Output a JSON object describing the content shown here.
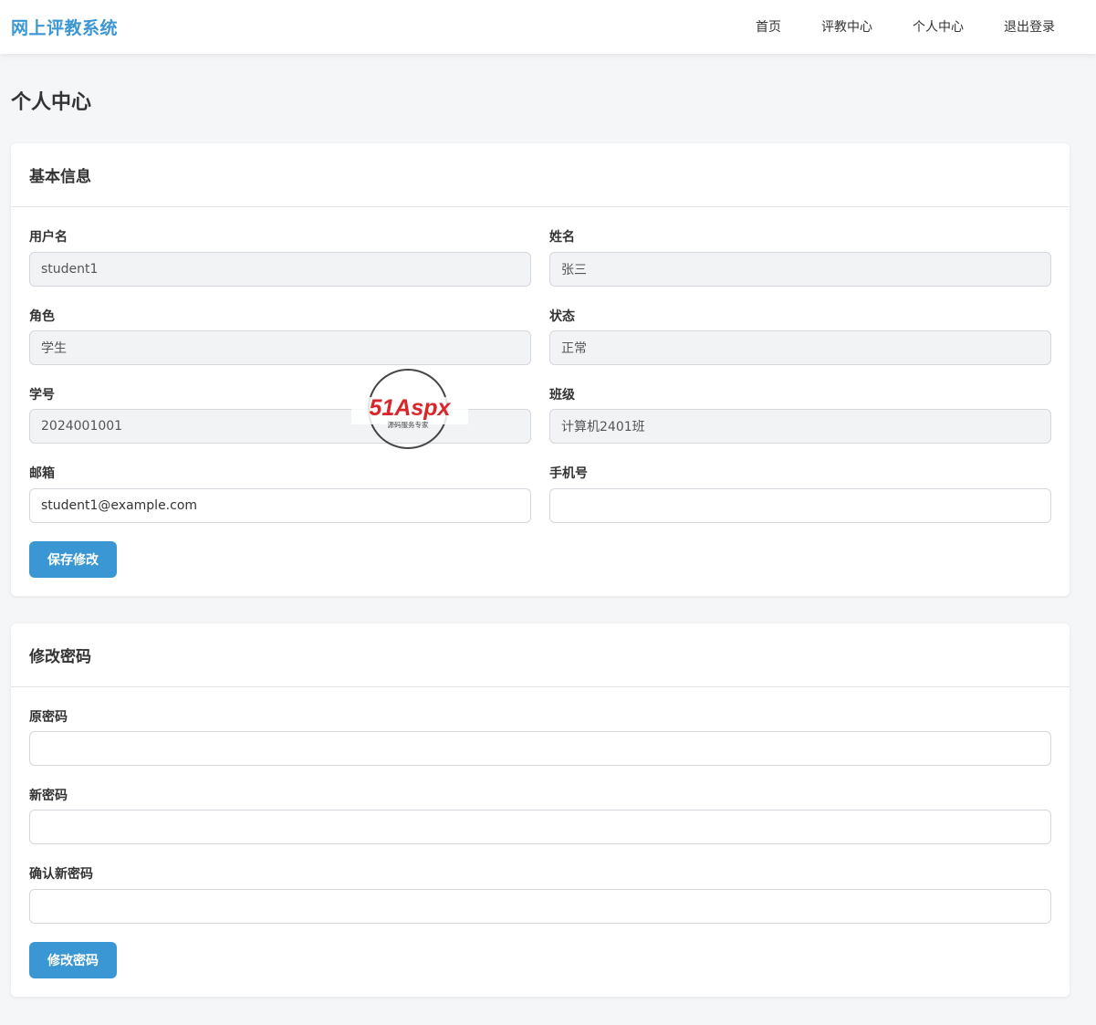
{
  "navbar": {
    "brand": "网上评教系统",
    "items": [
      {
        "label": "首页"
      },
      {
        "label": "评教中心"
      },
      {
        "label": "个人中心"
      },
      {
        "label": "退出登录"
      }
    ]
  },
  "page_title": "个人中心",
  "basic_info": {
    "title": "基本信息",
    "username": {
      "label": "用户名",
      "value": "student1"
    },
    "name": {
      "label": "姓名",
      "value": "张三"
    },
    "role": {
      "label": "角色",
      "value": "学生"
    },
    "status": {
      "label": "状态",
      "value": "正常"
    },
    "student_id": {
      "label": "学号",
      "value": "2024001001"
    },
    "class": {
      "label": "班级",
      "value": "计算机2401班"
    },
    "email": {
      "label": "邮箱",
      "value": "student1@example.com"
    },
    "phone": {
      "label": "手机号",
      "value": ""
    },
    "save_button": "保存修改"
  },
  "password": {
    "title": "修改密码",
    "old": {
      "label": "原密码",
      "value": ""
    },
    "new": {
      "label": "新密码",
      "value": ""
    },
    "confirm": {
      "label": "确认新密码",
      "value": ""
    },
    "submit_button": "修改密码"
  },
  "watermark": {
    "brand": "51Aspx",
    "tagline": "源码服务专家"
  },
  "colors": {
    "accent": "#3b97d3",
    "background": "#f5f6f8",
    "readonly_bg": "#f2f3f5"
  }
}
